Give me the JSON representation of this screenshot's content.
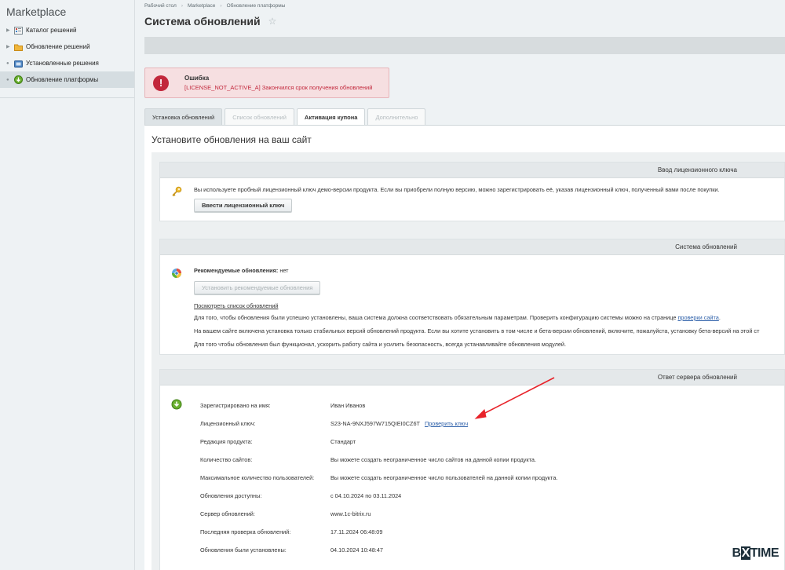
{
  "sidebar": {
    "title": "Marketplace",
    "items": [
      {
        "label": "Каталог решений",
        "icon": "catalog-icon"
      },
      {
        "label": "Обновление решений",
        "icon": "folder-icon"
      },
      {
        "label": "Установленные решения",
        "icon": "installed-icon"
      },
      {
        "label": "Обновление платформы",
        "icon": "platform-update-icon",
        "active": true
      }
    ]
  },
  "breadcrumb": [
    "Рабочий стол",
    "Marketplace",
    "Обновление платформы"
  ],
  "page_title": "Система обновлений",
  "error": {
    "title": "Ошибка",
    "message": "[LICENSE_NOT_ACTIVE_A] Закончился срок получения обновлений"
  },
  "tabs": [
    {
      "label": "Установка обновлений",
      "state": "active"
    },
    {
      "label": "Список обновлений",
      "state": "disabled"
    },
    {
      "label": "Активация купона",
      "state": "bold"
    },
    {
      "label": "Дополнительно",
      "state": "disabled"
    }
  ],
  "content_title": "Установите обновления на ваш сайт",
  "license_panel": {
    "header": "Ввод лицензионного ключа",
    "text": "Вы используете пробный лицензионный ключ демо-версии продукта. Если вы приобрели полную версию, можно зарегистрировать её, указав лицензионный ключ, полученный вами после покупки.",
    "button": "Ввести лицензионный ключ"
  },
  "system_panel": {
    "header": "Система обновлений",
    "recommended_label": "Рекомендуемые обновления:",
    "recommended_value": "нет",
    "install_button": "Установить рекомендуемые обновления",
    "view_list_link": "Посмотреть список обновлений",
    "line1_text": "Для того, чтобы обновления были успешно установлены, ваша система должна соответствовать обязательным параметрам. Проверить конфигурацию системы можно на странице",
    "line1_link": "проверки сайта",
    "line2": "На вашем сайте включена установка только стабильных версий обновлений продукта. Если вы хотите установить в том числе и бета-версии обновлений, включите, пожалуйста, установку бета-версий на этой ст",
    "line3": "Для того чтобы обновления был функционал, ускорить работу сайта и усилить безопасность, всегда устанавливайте обновления модулей."
  },
  "server_panel": {
    "header": "Ответ сервера обновлений",
    "rows": [
      {
        "key": "Зарегистрировано на имя:",
        "value": "Иван Иванов"
      },
      {
        "key": "Лицензионный ключ:",
        "value": "S23-NA-9NXJ597W715QIEI0CZ6T",
        "link": "Проверить ключ"
      },
      {
        "key": "Редакция продукта:",
        "value": "Стандарт"
      },
      {
        "key": "Количество сайтов:",
        "value": "Вы можете создать неограниченное число сайтов на данной копии продукта."
      },
      {
        "key": "Максимальное количество пользователей:",
        "value": "Вы можете создать неограниченное число пользователей на данной копии продукта."
      },
      {
        "key": "Обновления доступны:",
        "value": "с 04.10.2024 по 03.11.2024"
      },
      {
        "key": "Сервер обновлений:",
        "value": "www.1c-bitrix.ru"
      },
      {
        "key": "Последняя проверка обновлений:",
        "value": "17.11.2024 06:48:09"
      },
      {
        "key": "Обновления были установлены:",
        "value": "04.10.2024 10:48:47"
      }
    ]
  },
  "watermark": {
    "prefix": "B",
    "x": "X",
    "suffix": "TIME"
  },
  "colors": {
    "error": "#c2273b",
    "link": "#2b5ea8",
    "arrow": "#e8232a"
  }
}
